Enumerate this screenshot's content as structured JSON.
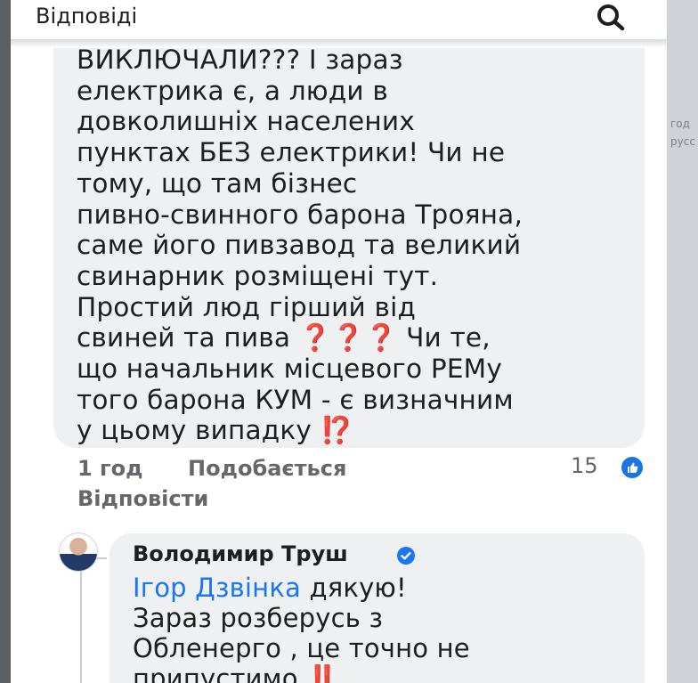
{
  "header": {
    "title": "Відповіді",
    "search_icon": "search-icon"
  },
  "comment": {
    "lines": [
      "ВИКЛЮЧАЛИ??? І зараз",
      "електрика є, а люди в",
      "довколишніх населених",
      "пунктах БЕЗ електрики! Чи не",
      "тому, що там бізнес",
      "пивно-свинного барона Трояна,",
      "саме його пивзавод та великий",
      "свинарник розміщені тут.",
      "Простий люд гірший від",
      "свиней та пива",
      "❓❓❓",
      "Чи те,",
      "що начальник місцевого РЕМу",
      "того барона КУМ - є визначним",
      "у цьому випадку",
      "⁉️"
    ],
    "time": "1 год",
    "like_label": "Подобається",
    "reply_label": "Відповісти",
    "reaction_count": "15",
    "reaction_icon": "like-reaction-icon"
  },
  "reply": {
    "author": "Володимир Труш",
    "verified_icon": "verified-badge-icon",
    "mention": "Ігор Дзвінка",
    "after_mention": "дякую!",
    "lines": [
      "Зараз розберусь з",
      "Обленерго , це точно не",
      "припустимо"
    ],
    "emoji": "‼️"
  },
  "background_text": {
    "ghost1": "год",
    "ghost2": "русс"
  },
  "colors": {
    "accent": "#1877f2",
    "bubble": "#eff0f2",
    "text": "#1c1e21",
    "muted": "#65676b",
    "emoji_red": "#e0245e"
  }
}
